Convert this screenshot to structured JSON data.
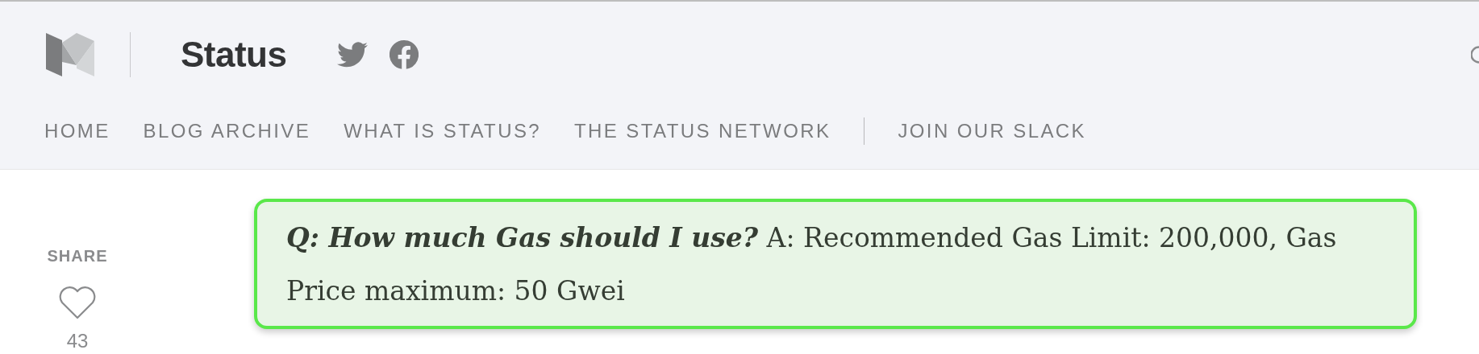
{
  "header": {
    "title": "Status",
    "nav": [
      {
        "label": "HOME",
        "separator_before": false
      },
      {
        "label": "BLOG ARCHIVE",
        "separator_before": false
      },
      {
        "label": "WHAT IS STATUS?",
        "separator_before": false
      },
      {
        "label": "THE STATUS NETWORK",
        "separator_before": false
      },
      {
        "label": "JOIN OUR SLACK",
        "separator_before": true
      }
    ]
  },
  "share": {
    "label": "SHARE",
    "likes": "43"
  },
  "callout": {
    "question": "Q: How much Gas should I use?",
    "answer": "A: Recommended Gas Limit: 200,000, Gas Price maximum: 50 Gwei"
  }
}
